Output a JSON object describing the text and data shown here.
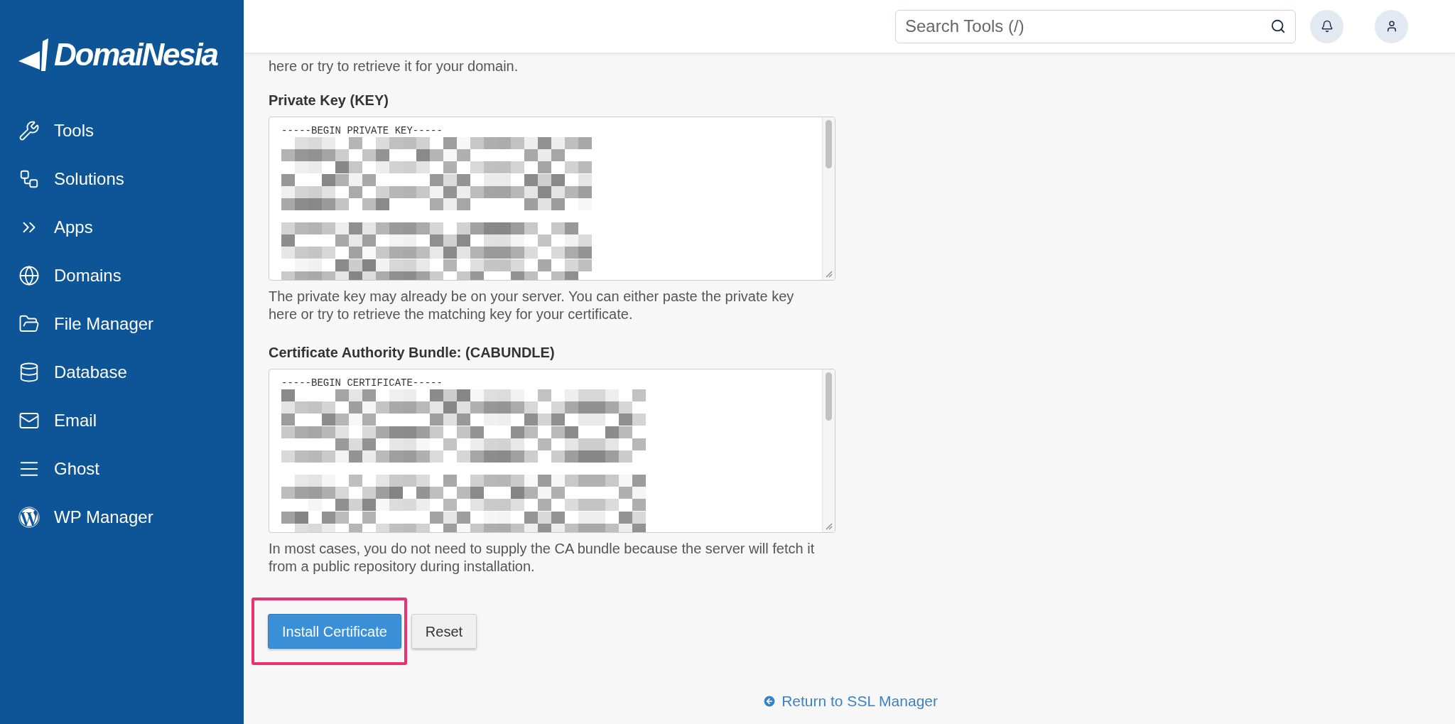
{
  "sidebar": {
    "logo": "DomaiNesia",
    "items": [
      {
        "label": "Tools"
      },
      {
        "label": "Solutions"
      },
      {
        "label": "Apps"
      },
      {
        "label": "Domains"
      },
      {
        "label": "File Manager"
      },
      {
        "label": "Database"
      },
      {
        "label": "Email"
      },
      {
        "label": "Ghost"
      },
      {
        "label": "WP Manager"
      }
    ]
  },
  "header": {
    "search": {
      "placeholder": "Search Tools (/)"
    }
  },
  "intro_text": "here or try to retrieve it for your domain.",
  "fields": [
    {
      "label": "Private Key (KEY)",
      "value": "-----BEGIN PRIVATE KEY-----",
      "help": "The private key may already be on your server. You can either paste the private key here or try to retrieve the matching key for your certificate."
    },
    {
      "label": "Certificate Authority Bundle: (CABUNDLE)",
      "value": "-----BEGIN CERTIFICATE-----",
      "help": "In most cases, you do not need to supply the CA bundle because the server will fetch it from a public repository during installation."
    }
  ],
  "buttons": [
    {
      "label": "Install Certificate",
      "kind": "primary",
      "highlighted": true
    },
    {
      "label": "Reset",
      "kind": "secondary",
      "highlighted": false
    }
  ],
  "return_link": "Return to SSL Manager"
}
